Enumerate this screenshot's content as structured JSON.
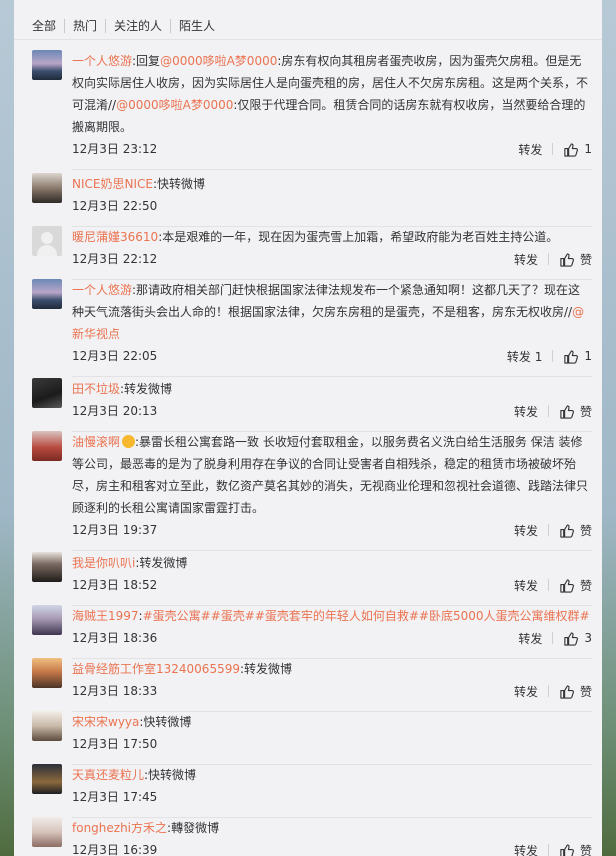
{
  "tabs": [
    "全部",
    "热门",
    "关注的人",
    "陌生人"
  ],
  "comments": [
    {
      "name": "一个人悠游",
      "segments": [
        ":回复",
        {
          "at": "@0000哆啦A梦0000"
        },
        ":房东有权向其租房者蛋壳收房，因为蛋壳欠房租。但是无权向实际居住人收房，因为实际居住人是向蛋壳租的房，居住人不欠房东房租。这是两个关系，不可混淆//",
        {
          "at": "@0000哆啦A梦0000"
        },
        ":仅限于代理合同。租赁合同的话房东就有权收房，当然要给合理的搬离期限。"
      ],
      "time": "12月3日 23:12",
      "forward": "转发",
      "like": "1"
    },
    {
      "name": "NICE奶思NICE",
      "segments": [
        ":快转微博"
      ],
      "time": "12月3日 22:50",
      "forward": "",
      "like": ""
    },
    {
      "name": "暖尼蒲嫤36610",
      "segments": [
        ":本是艰难的一年，现在因为蛋壳雪上加霜，希望政府能为老百姓主持公道。"
      ],
      "time": "12月3日 22:12",
      "forward": "转发",
      "like": "赞"
    },
    {
      "name": "一个人悠游",
      "segments": [
        ":那请政府相关部门赶快根据国家法律法规发布一个紧急通知啊！这都几天了？现在这种天气流落街头会出人命的！根据国家法律，欠房东房租的是蛋壳，不是租客，房东无权收房//",
        {
          "at": "@新华视点"
        }
      ],
      "time": "12月3日 22:05",
      "forward": "转发 1",
      "like": "1"
    },
    {
      "name": "田不垃圾",
      "segments": [
        ":转发微博"
      ],
      "time": "12月3日 20:13",
      "forward": "转发",
      "like": "赞"
    },
    {
      "name": "油慢滚啊",
      "emoji": true,
      "segments": [
        ":暴雷长租公寓套路一致 长收短付套取租金，以服务费名义洗白给生活服务 保洁 装修等公司，最恶毒的是为了脱身利用存在争议的合同让受害者自相残杀，稳定的租赁市场被破坏殆尽，房主和租客对立至此，数亿资产莫名其妙的消失，无视商业伦理和忽视社会道德、践踏法律只顾逐利的长租公寓请国家雷霆打击。"
      ],
      "time": "12月3日 19:37",
      "forward": "转发",
      "like": "赞"
    },
    {
      "name": "我是你叭叭i",
      "segments": [
        ":转发微博"
      ],
      "time": "12月3日 18:52",
      "forward": "转发",
      "like": "赞"
    },
    {
      "name": "海贼王1997",
      "segments": [
        ":",
        {
          "at": "#蛋壳公寓##蛋壳##蛋壳套牢的年轻人如何自救##卧底5000人蛋壳公寓维权群#"
        }
      ],
      "time": "12月3日 18:36",
      "forward": "转发",
      "like": "3"
    },
    {
      "name": "益骨经筋工作室13240065599",
      "segments": [
        ":转发微博"
      ],
      "time": "12月3日 18:33",
      "forward": "转发",
      "like": "赞"
    },
    {
      "name": "宋宋宋wyya",
      "segments": [
        ":快转微博"
      ],
      "time": "12月3日 17:50",
      "forward": "",
      "like": ""
    },
    {
      "name": "天真还麦粒儿",
      "segments": [
        ":快转微博"
      ],
      "time": "12月3日 17:45",
      "forward": "",
      "like": ""
    },
    {
      "name": "fonghezhi方禾之",
      "segments": [
        ":轉發微博"
      ],
      "time": "12月3日 16:39",
      "forward": "转发",
      "like": "赞"
    }
  ],
  "colors": {
    "link": "#eb7350",
    "panel": "#f2f2f5",
    "text": "#333333"
  }
}
